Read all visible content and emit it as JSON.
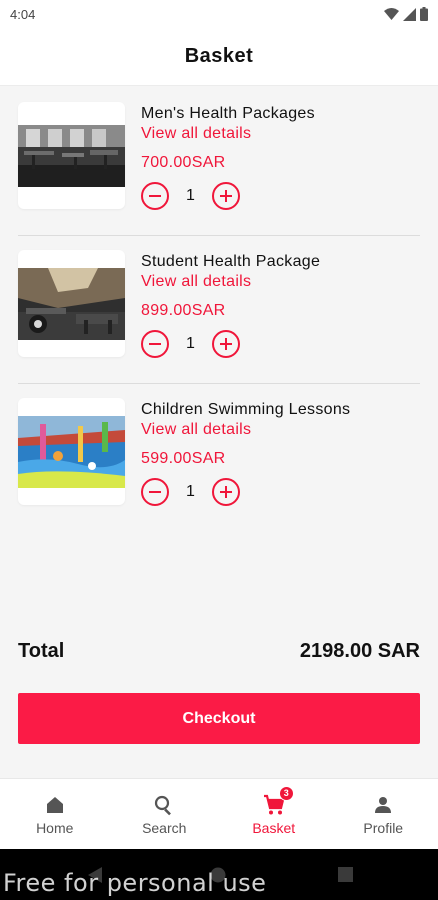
{
  "status_bar": {
    "time": "4:04"
  },
  "header": {
    "title": "Basket"
  },
  "items": [
    {
      "title": "Men's Health Packages",
      "link": "View all details",
      "price": "700.00SAR",
      "qty": "1"
    },
    {
      "title": "Student Health Package",
      "link": "View all details",
      "price": "899.00SAR",
      "qty": "1"
    },
    {
      "title": "Children Swimming Lessons",
      "link": "View all details",
      "price": "599.00SAR",
      "qty": "1"
    }
  ],
  "summary": {
    "total_label": "Total",
    "total_value": "2198.00 SAR"
  },
  "checkout": {
    "label": "Checkout"
  },
  "nav": {
    "home": "Home",
    "search": "Search",
    "basket": "Basket",
    "basket_badge": "3",
    "profile": "Profile"
  },
  "watermark": "Free for personal use",
  "colors": {
    "accent": "#f0163a",
    "checkout": "#fb1b46",
    "background": "#f5f5f5"
  },
  "icons": [
    "wifi-icon",
    "signal-icon",
    "battery-icon",
    "minus-circle-icon",
    "plus-circle-icon",
    "home-icon",
    "search-icon",
    "cart-icon",
    "person-icon",
    "back-icon",
    "home-circle-icon",
    "recents-icon"
  ]
}
